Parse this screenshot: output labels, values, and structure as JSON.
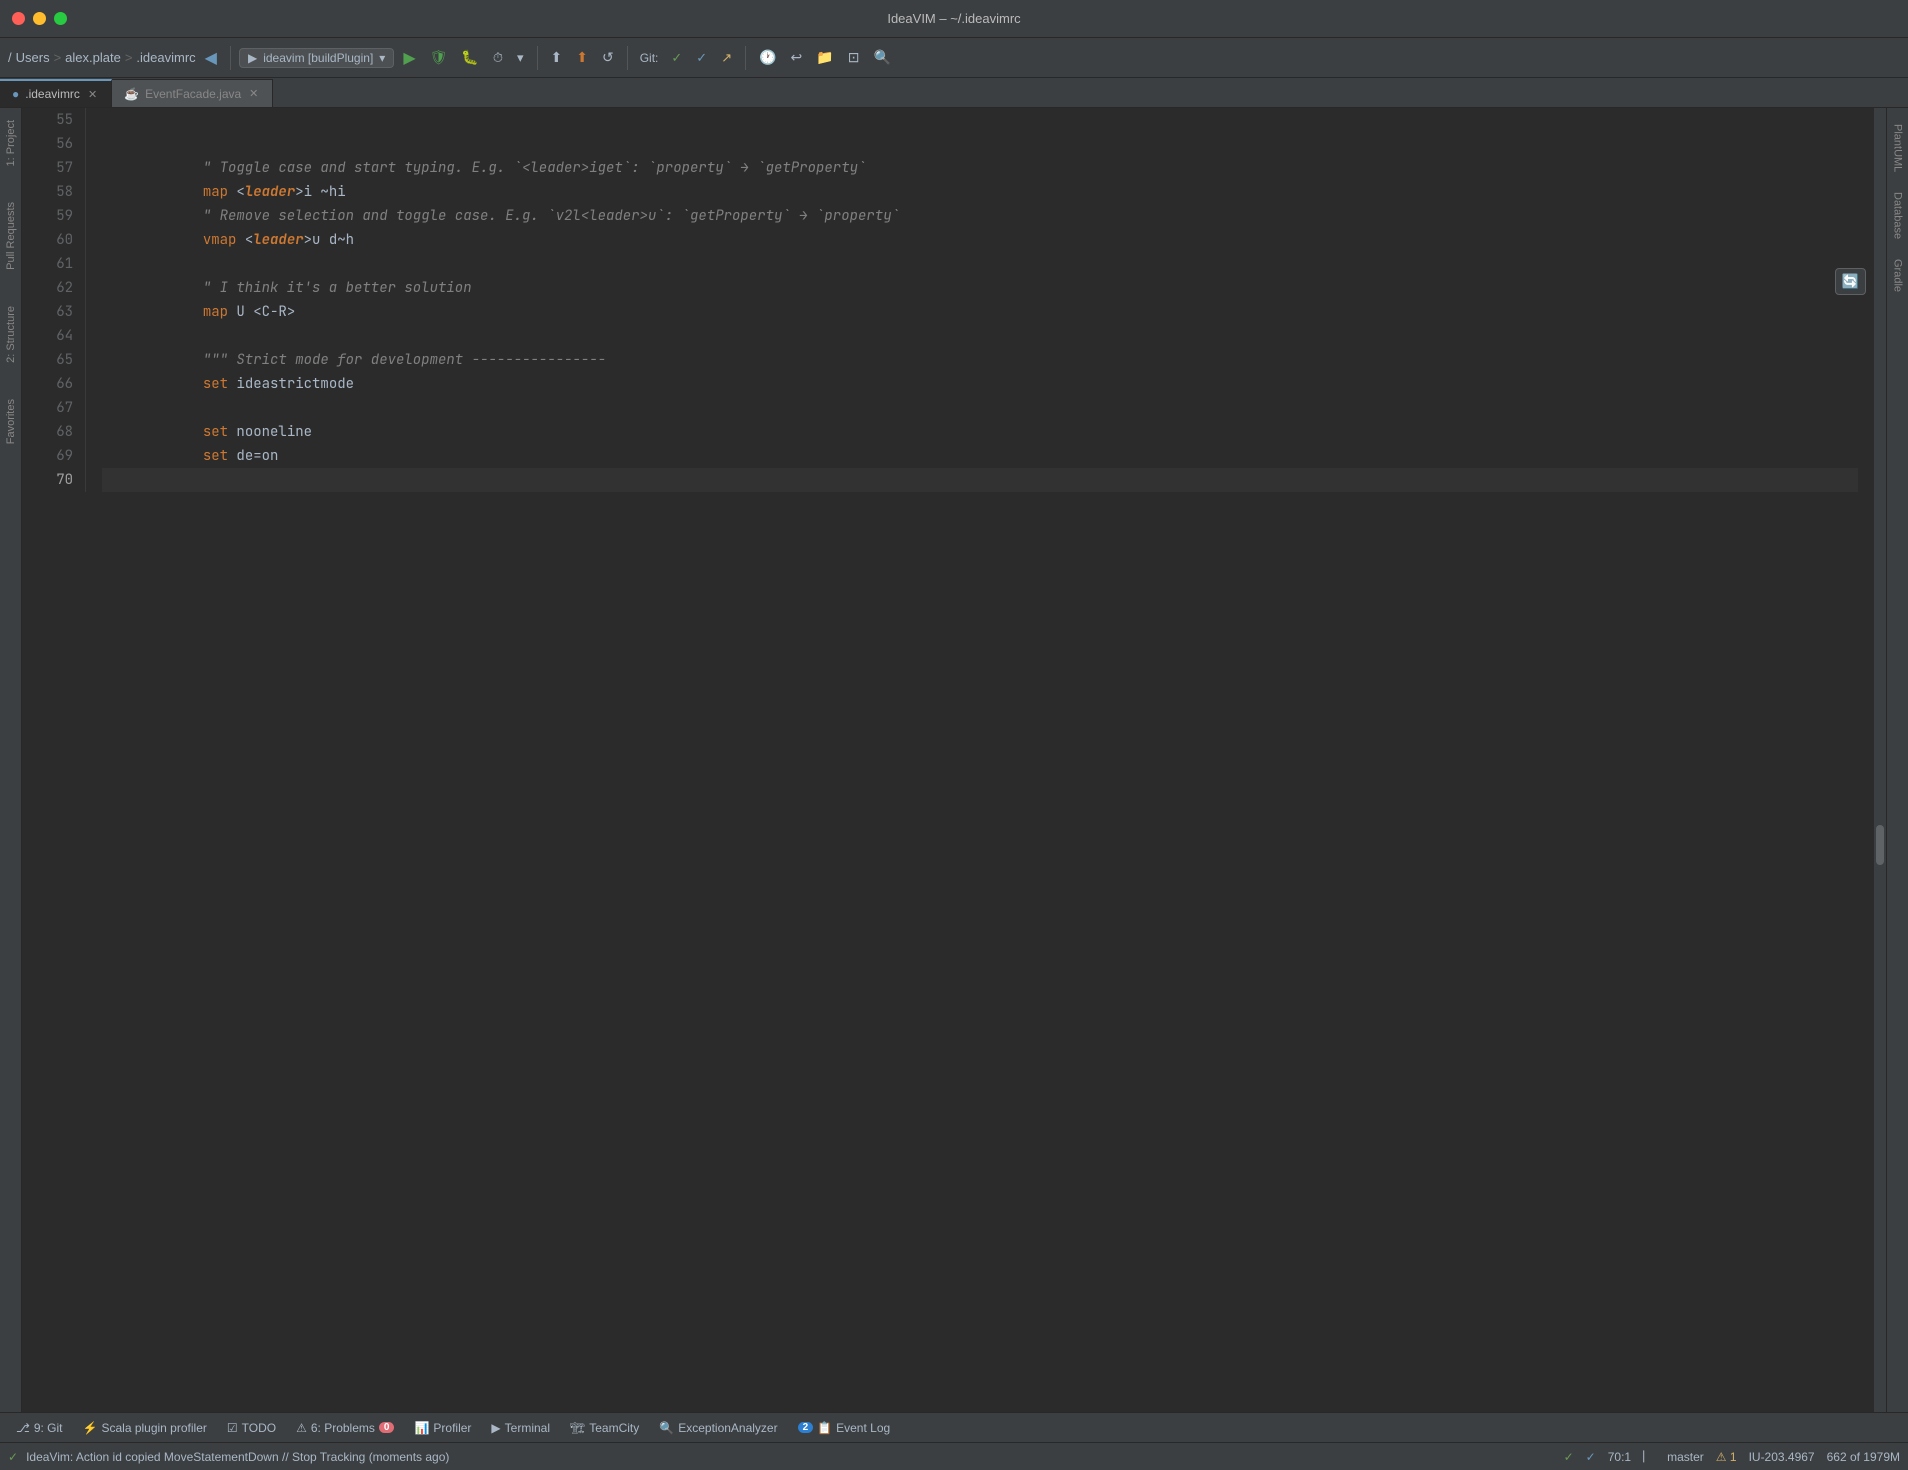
{
  "window": {
    "title": "IdeaVIM – ~/.ideavimrc"
  },
  "titleBar": {
    "title": "IdeaVIM – ~/.ideavimrc"
  },
  "breadcrumb": {
    "slash": "/",
    "users": "Users",
    "sep1": ">",
    "username": "alex.plate",
    "sep2": ">",
    "filename": ".ideavimrc"
  },
  "runConfig": {
    "label": "ideavim [buildPlugin]",
    "dropdown": "▾"
  },
  "tabs": [
    {
      "label": ".ideavimrc",
      "active": true,
      "icon": "vim-icon"
    },
    {
      "label": "EventFacade.java",
      "active": false,
      "icon": "java-icon"
    }
  ],
  "editor": {
    "lines": [
      {
        "num": 55,
        "content": "",
        "active": false
      },
      {
        "num": 56,
        "content": "\" Toggle case and start typing. E.g. `<leader>iget`: `property` → `getProperty`",
        "active": false,
        "type": "comment"
      },
      {
        "num": 57,
        "content": "map <leader>i ~hi",
        "active": false,
        "type": "code"
      },
      {
        "num": 58,
        "content": "\" Remove selection and toggle case. E.g. `v2l<leader>u`: `getProperty` → `property`",
        "active": false,
        "type": "comment"
      },
      {
        "num": 59,
        "content": "vmap <leader>u d~h",
        "active": false,
        "type": "code"
      },
      {
        "num": 60,
        "content": "",
        "active": false
      },
      {
        "num": 61,
        "content": "\" I think it's a better solution",
        "active": false,
        "type": "comment"
      },
      {
        "num": 62,
        "content": "map U <C-R>",
        "active": false,
        "type": "code"
      },
      {
        "num": 63,
        "content": "",
        "active": false
      },
      {
        "num": 64,
        "content": "\"\"\" Strict mode for development ----------------",
        "active": false,
        "type": "comment"
      },
      {
        "num": 65,
        "content": "set ideastrictmode",
        "active": false,
        "type": "code"
      },
      {
        "num": 66,
        "content": "",
        "active": false
      },
      {
        "num": 67,
        "content": "set nooneline",
        "active": false,
        "type": "code"
      },
      {
        "num": 68,
        "content": "set de=on",
        "active": false,
        "type": "code"
      },
      {
        "num": 69,
        "content": "",
        "active": false
      },
      {
        "num": 70,
        "content": "",
        "active": true
      }
    ]
  },
  "rightPanels": [
    {
      "label": "PlantUML"
    },
    {
      "label": "Database"
    },
    {
      "label": "Gradle"
    }
  ],
  "leftPanels": [
    {
      "label": "1: Project"
    },
    {
      "label": "Pull Requests"
    },
    {
      "label": "2: Structure"
    },
    {
      "label": "Favorites"
    }
  ],
  "bottomTools": [
    {
      "label": "9: Git",
      "icon": "git-icon",
      "badge": null
    },
    {
      "label": "Scala plugin profiler",
      "icon": "profiler-icon",
      "badge": null
    },
    {
      "label": "TODO",
      "icon": "todo-icon",
      "badge": null
    },
    {
      "label": "6: Problems",
      "icon": "problems-icon",
      "badge": "0"
    },
    {
      "label": "Profiler",
      "icon": "profiler2-icon",
      "badge": null
    },
    {
      "label": "Terminal",
      "icon": "terminal-icon",
      "badge": null
    },
    {
      "label": "TeamCity",
      "icon": "teamcity-icon",
      "badge": null
    },
    {
      "label": "ExceptionAnalyzer",
      "icon": "exception-icon",
      "badge": null
    },
    {
      "label": "Event Log",
      "icon": "eventlog-icon",
      "badge": "2"
    }
  ],
  "statusBar": {
    "message": "IdeaVim: Action id copied MoveStatementDown // Stop Tracking (moments ago)",
    "checkGreen": "✓",
    "checkBlue": "✓",
    "position": "70:1",
    "vcs": "master",
    "warnings": "⚠",
    "warningCount": "1",
    "ide": "IU-203.4967",
    "memory": "662 of 1979M"
  }
}
